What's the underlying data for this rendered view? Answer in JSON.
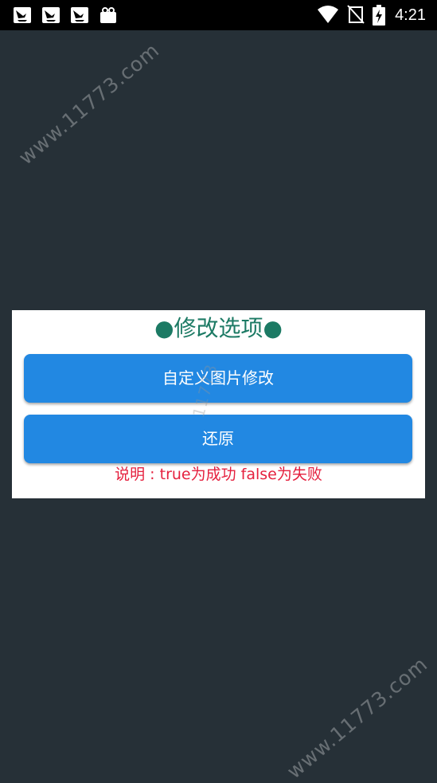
{
  "status_bar": {
    "time": "4:21",
    "notification_icons": [
      "bird-notification-icon",
      "bird-notification-icon",
      "bird-notification-icon",
      "shopping-bag-icon"
    ],
    "system_icons": [
      "wifi-icon",
      "no-sim-icon",
      "battery-charging-icon"
    ]
  },
  "watermark": {
    "text": "www.11773.com",
    "center_text": "11773"
  },
  "dialog": {
    "title": "●修改选项●",
    "custom_image_button": "自定义图片修改",
    "restore_button": "还原",
    "note": "说明 : true为成功    false为失败"
  },
  "colors": {
    "background": "#263037",
    "title": "#1c7a64",
    "button": "#2288e2",
    "note": "#e5203e"
  }
}
